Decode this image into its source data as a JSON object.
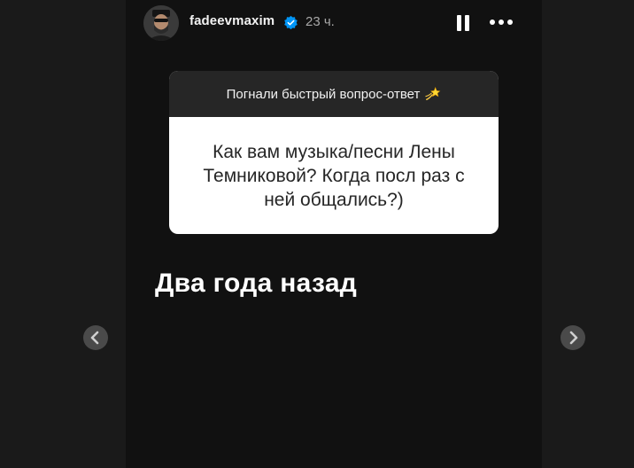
{
  "header": {
    "username": "fadeevmaxim",
    "time": "23 ч.",
    "icons": [
      "avatar",
      "verified-badge-icon",
      "pause-icon",
      "more-icon"
    ]
  },
  "question_card": {
    "prompt": "Погнали быстрый вопрос-ответ",
    "prompt_emoji_icon": "dizzy-star-emoji",
    "question": "Как вам музыка/песни Лены Темниковой? Когда посл раз с ней общались?)"
  },
  "answer_text": "Два года назад",
  "navigation": {
    "prev_icon": "chevron-left-icon",
    "next_icon": "chevron-right-icon"
  },
  "colors": {
    "background": "#1a1a1a",
    "story_background": "#111111",
    "card_header": "#262626",
    "card_body": "#ffffff",
    "verified": "#0095f6"
  }
}
